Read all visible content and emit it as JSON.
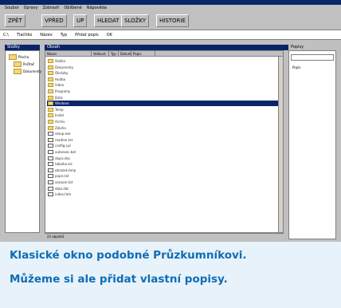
{
  "menu": [
    "Soubor",
    "Úpravy",
    "Zobrazit",
    "Oblíbené",
    "Nápověda"
  ],
  "toolbar": {
    "buttons": [
      "ZPĚT",
      "VPŘED",
      "UP",
      "HLEDAT",
      "SLOŽKY",
      "HISTORIE"
    ]
  },
  "address": [
    "C:\\",
    "Tlačítko",
    "Název",
    "Typ",
    "Přidat popis",
    "OK"
  ],
  "panels": {
    "tree_title": "Složky",
    "list_title": "Obsah",
    "right_title": "Popisy"
  },
  "tree": [
    "Plocha",
    "Počítač",
    "Dokumenty"
  ],
  "list_headers": [
    "Název",
    "Velikost",
    "Typ",
    "Datum",
    "Popis"
  ],
  "files": [
    {
      "name": "Složka",
      "size": "",
      "type": "",
      "date": "",
      "kind": "folder"
    },
    {
      "name": "Dokumenty",
      "size": "",
      "type": "",
      "date": "",
      "kind": "folder"
    },
    {
      "name": "Obrázky",
      "size": "",
      "type": "",
      "date": "",
      "kind": "folder"
    },
    {
      "name": "Hudba",
      "size": "",
      "type": "",
      "date": "",
      "kind": "folder"
    },
    {
      "name": "Video",
      "size": "",
      "type": "",
      "date": "",
      "kind": "folder"
    },
    {
      "name": "Programy",
      "size": "",
      "type": "",
      "date": "",
      "kind": "folder"
    },
    {
      "name": "Data",
      "size": "",
      "type": "",
      "date": "",
      "kind": "folder"
    },
    {
      "name": "Windows",
      "size": "",
      "type": "",
      "date": "",
      "kind": "folder",
      "selected": true
    },
    {
      "name": "Temp",
      "size": "",
      "type": "",
      "date": "",
      "kind": "folder"
    },
    {
      "name": "Instal",
      "size": "",
      "type": "",
      "date": "",
      "kind": "folder"
    },
    {
      "name": "Archiv",
      "size": "",
      "type": "",
      "date": "",
      "kind": "folder"
    },
    {
      "name": "Záloha",
      "size": "",
      "type": "",
      "date": "",
      "kind": "folder"
    },
    {
      "name": "setup.exe",
      "size": "",
      "type": "",
      "date": "",
      "kind": "file"
    },
    {
      "name": "readme.txt",
      "size": "",
      "type": "",
      "date": "",
      "kind": "file"
    },
    {
      "name": "config.sys",
      "size": "",
      "type": "",
      "date": "",
      "kind": "file"
    },
    {
      "name": "autoexec.bat",
      "size": "",
      "type": "",
      "date": "",
      "kind": "file"
    },
    {
      "name": "dopis.doc",
      "size": "",
      "type": "",
      "date": "",
      "kind": "file"
    },
    {
      "name": "tabulka.xls",
      "size": "",
      "type": "",
      "date": "",
      "kind": "file"
    },
    {
      "name": "obrazek.bmp",
      "size": "",
      "type": "",
      "date": "",
      "kind": "file"
    },
    {
      "name": "popis.txt",
      "size": "",
      "type": "",
      "date": "",
      "kind": "file"
    },
    {
      "name": "seznam.txt",
      "size": "",
      "type": "",
      "date": "",
      "kind": "file"
    },
    {
      "name": "data.dat",
      "size": "",
      "type": "",
      "date": "",
      "kind": "file"
    },
    {
      "name": "index.htm",
      "size": "",
      "type": "",
      "date": "",
      "kind": "file"
    }
  ],
  "status": "23 objektů",
  "right_label": "Popis",
  "caption": {
    "line1": "Klasické okno podobné Průzkumníkovi.",
    "line2": "Můžeme si ale přidat vlastní popisy."
  },
  "colors": {
    "caption": "#0f6db4",
    "selection": "#0a246a",
    "background": "#e7f2fa"
  }
}
